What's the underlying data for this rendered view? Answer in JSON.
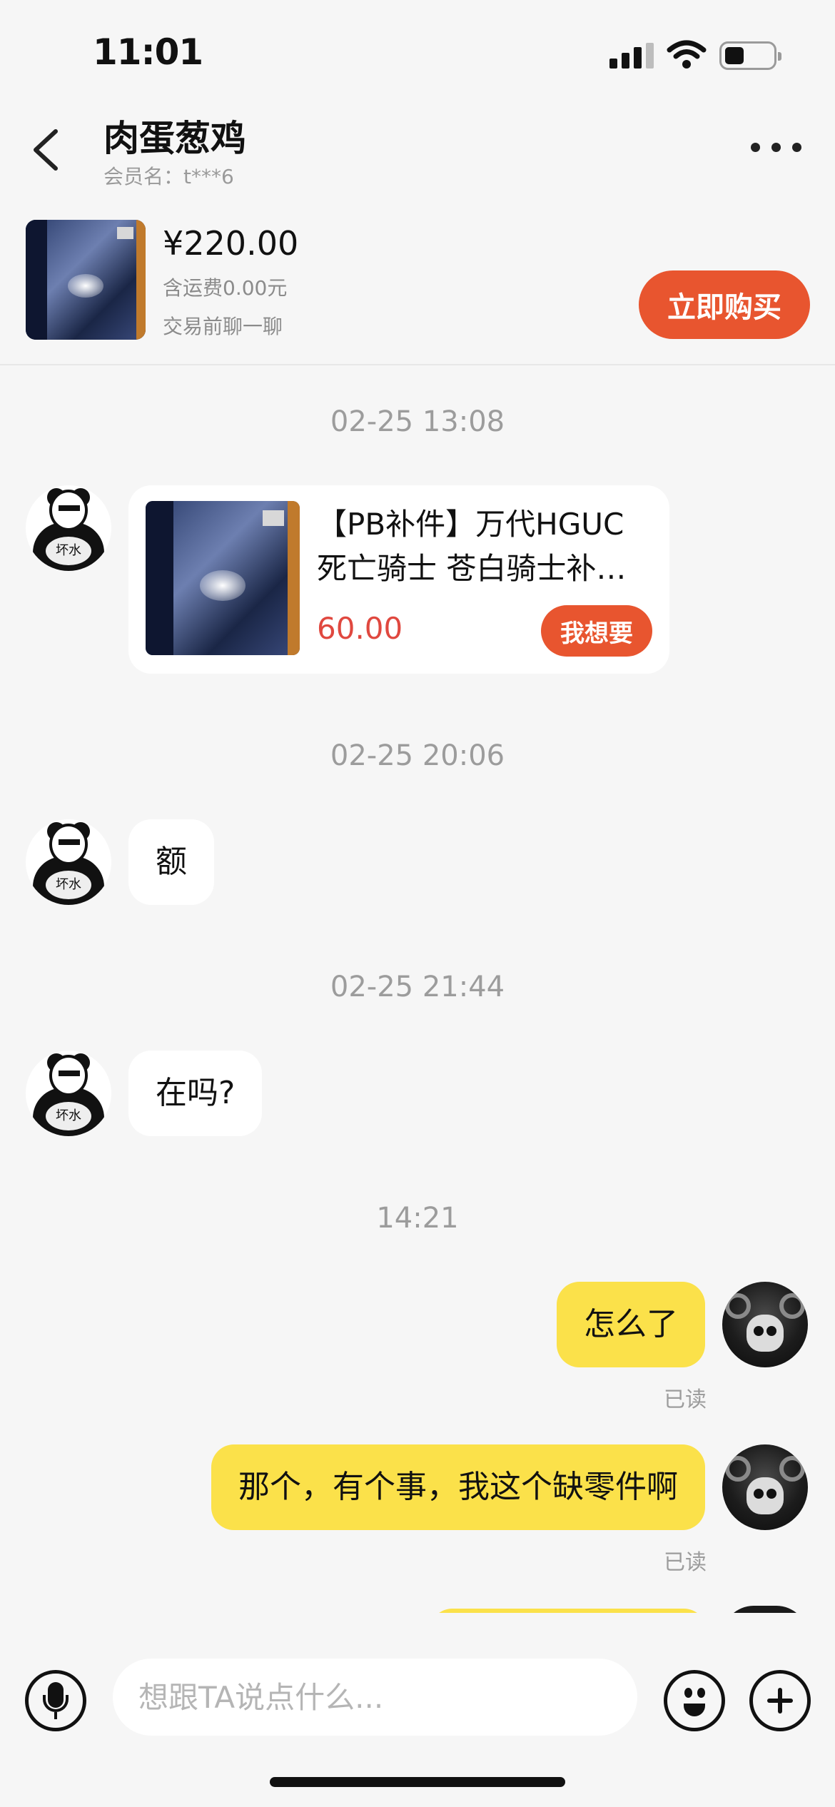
{
  "status_bar": {
    "time": "11:01"
  },
  "header": {
    "title": "肉蛋葱鸡",
    "member_label": "会员名：t***6"
  },
  "product": {
    "price": "¥220.00",
    "shipping": "含运费0.00元",
    "hint": "交易前聊一聊",
    "buy_label": "立即购买"
  },
  "messages": {
    "ts1": "02-25 13:08",
    "card": {
      "title": "【PB补件】万代HGUC 死亡骑士 苍白骑士补…",
      "price": "60.00",
      "want_label": "我想要"
    },
    "ts2": "02-25 20:06",
    "msg1": "额",
    "ts3": "02-25 21:44",
    "msg2": "在吗?",
    "ts4": "14:21",
    "msg3": "怎么了",
    "read1": "已读",
    "msg4": "那个，有个事，我这个缺零件啊",
    "read2": "已读",
    "avatar_badge": "坏水"
  },
  "input": {
    "placeholder": "想跟TA说点什么..."
  },
  "icons": [
    "back-icon",
    "more-icon",
    "signal-icon",
    "wifi-icon",
    "battery-icon",
    "voice-icon",
    "emoji-icon",
    "plus-icon"
  ],
  "colors": {
    "accent": "#e8552f",
    "price_red": "#e0483f",
    "outgoing_bubble": "#fbe14a",
    "background": "#f6f6f6"
  }
}
